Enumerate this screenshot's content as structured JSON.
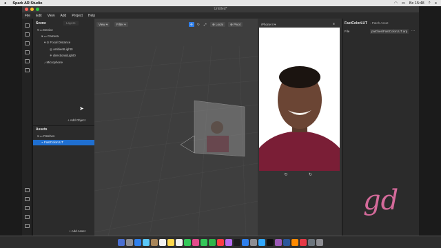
{
  "mac": {
    "app_name": "Spark AR Studio",
    "time": "Вс 15:48"
  },
  "window": {
    "title": "Untitled*"
  },
  "menu": [
    "File",
    "Edit",
    "View",
    "Add",
    "Project",
    "Help"
  ],
  "scene_panel": {
    "title": "Scene",
    "layers_tab": "Layers",
    "tree": [
      {
        "label": "Device",
        "depth": 0
      },
      {
        "label": "Camera",
        "depth": 1
      },
      {
        "label": "Focal Distance",
        "depth": 2
      },
      {
        "label": "ambientLight0",
        "depth": 3
      },
      {
        "label": "directionalLight0",
        "depth": 3
      },
      {
        "label": "Microphone",
        "depth": 1
      }
    ],
    "add_object": "+ Add Object",
    "assets_title": "Assets",
    "assets": [
      {
        "label": "Patches",
        "depth": 0
      },
      {
        "label": "FastColorLUT",
        "depth": 1,
        "selected": true
      }
    ],
    "add_asset": "+ Add Asset"
  },
  "viewport": {
    "view_label": "View",
    "filter_label": "Filter",
    "local_label": "Local",
    "pivot_label": "Pivot"
  },
  "simulator": {
    "device": "iPhone 8"
  },
  "inspector": {
    "title": "FastColorLUT",
    "subtitle": "- Patch Asset",
    "file_label": "File",
    "file_value": "patches/FastColorLUT.arp"
  },
  "watermark": "gd",
  "colors": {
    "accent": "#2f80ed",
    "selected": "#1f6fd1"
  }
}
